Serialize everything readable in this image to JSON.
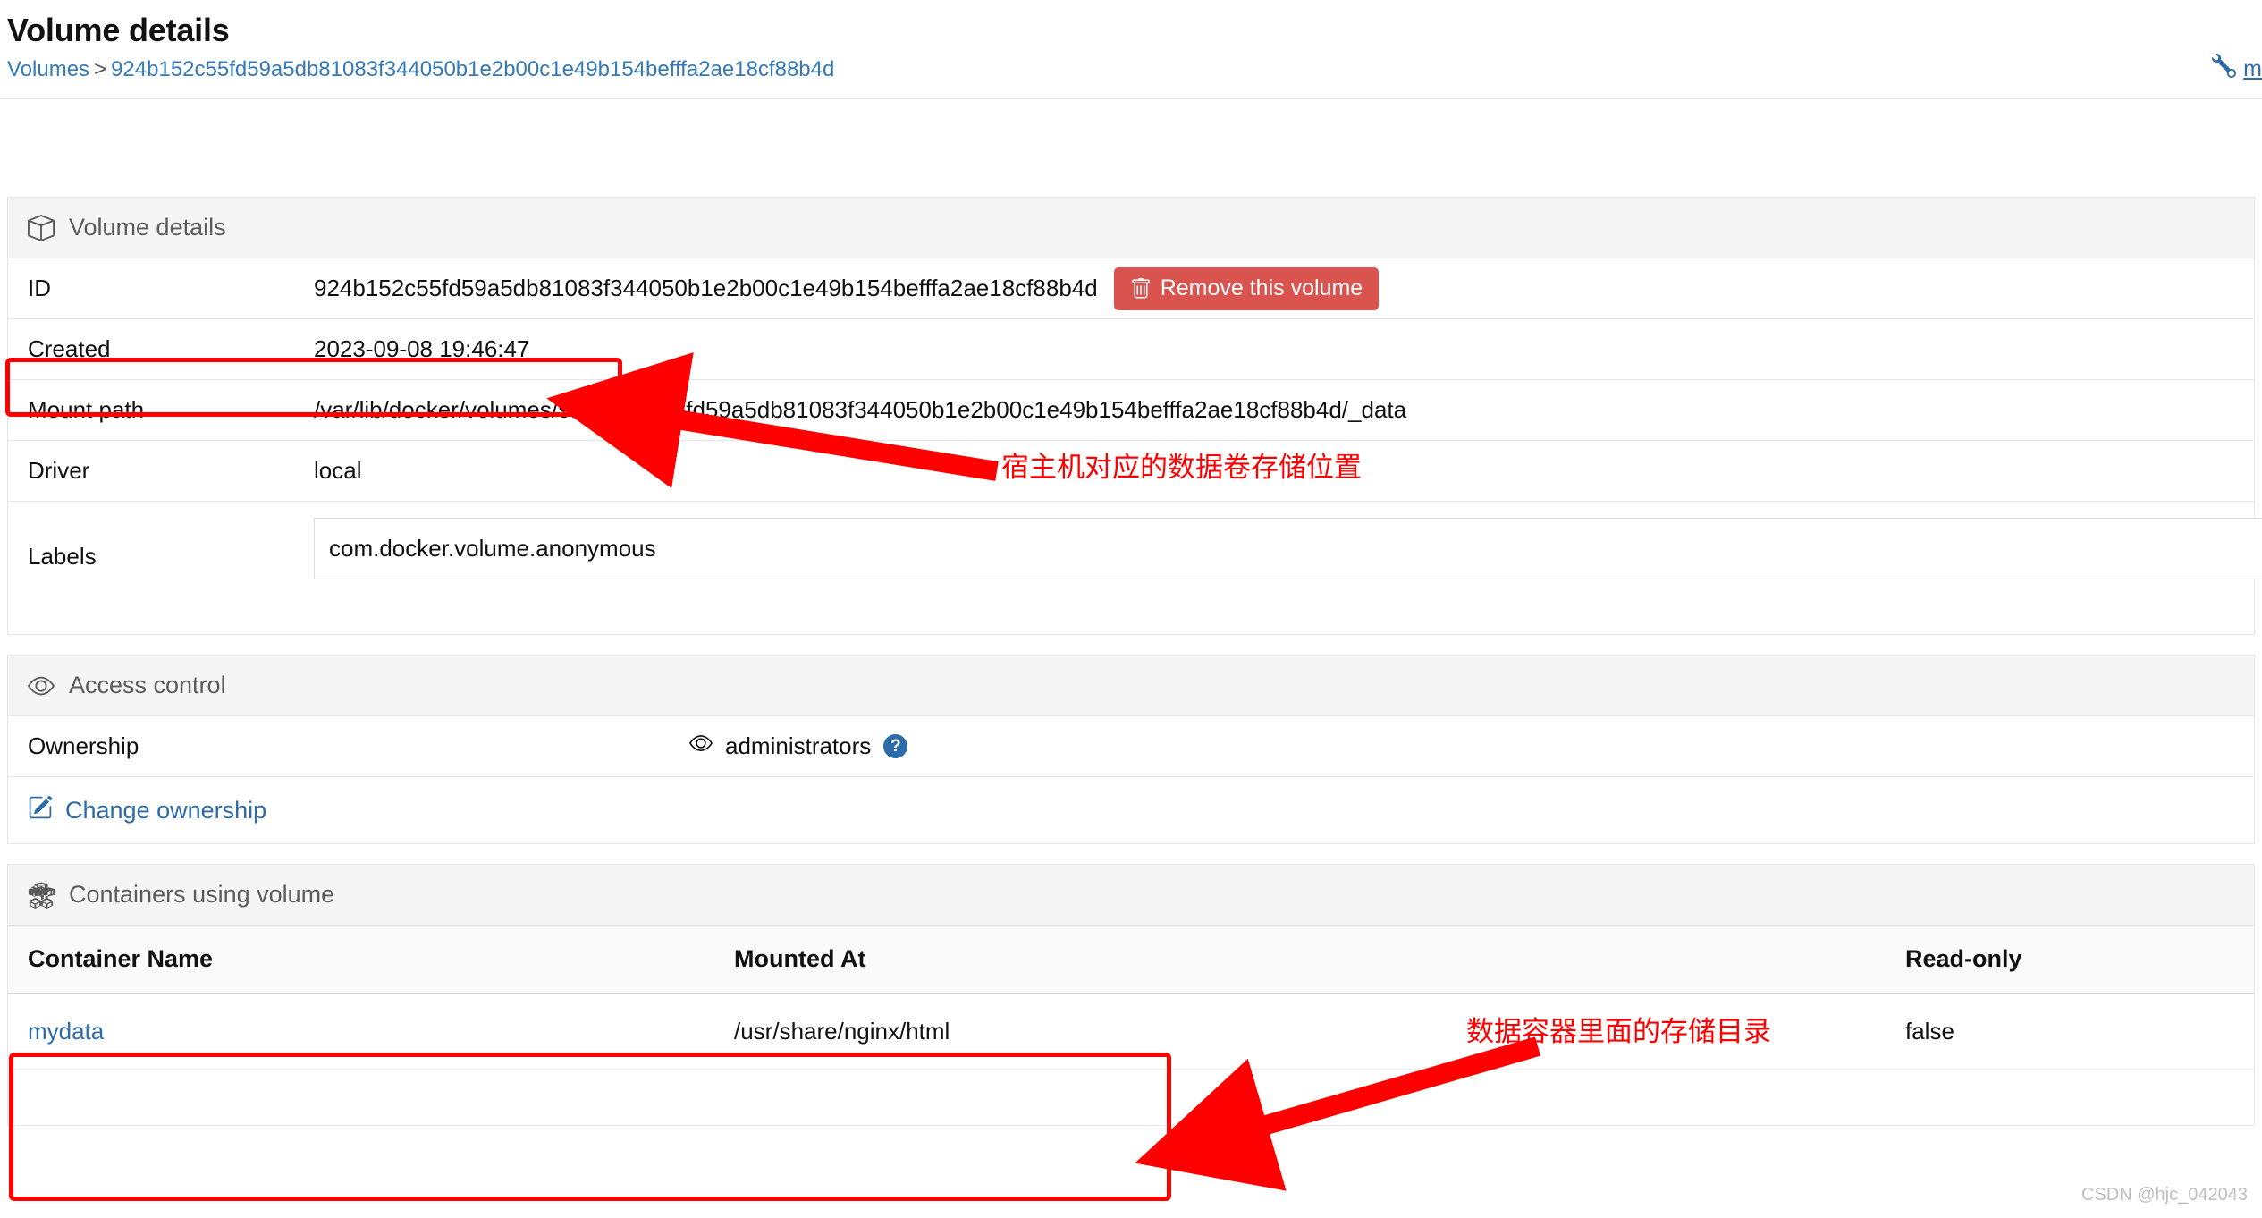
{
  "header": {
    "title": "Volume details",
    "breadcrumb": {
      "root": "Volumes",
      "separator": ">",
      "current": "924b152c55fd59a5db81083f344050b1e2b00c1e49b154befffa2ae18cf88b4d"
    },
    "right_link": {
      "icon": "wrench-icon",
      "label": "m"
    }
  },
  "volume_details": {
    "section_title": "Volume details",
    "section_icon": "cube-icon",
    "rows": [
      {
        "label": "ID",
        "value": "924b152c55fd59a5db81083f344050b1e2b00c1e49b154befffa2ae18cf88b4d"
      },
      {
        "label": "Created",
        "value": "2023-09-08 19:46:47"
      },
      {
        "label": "Mount path",
        "value": "/var/lib/docker/volumes/924b152c55fd59a5db81083f344050b1e2b00c1e49b154befffa2ae18cf88b4d/_data"
      },
      {
        "label": "Driver",
        "value": "local"
      },
      {
        "label": "Labels",
        "value": "com.docker.volume.anonymous"
      }
    ],
    "remove_button": {
      "label": "Remove this volume",
      "icon": "trash-icon",
      "color": "#d9534f"
    }
  },
  "access_control": {
    "section_title": "Access control",
    "section_icon": "eye-icon",
    "ownership_label": "Ownership",
    "ownership_value": "administrators",
    "ownership_icon": "eye-icon",
    "help_icon": "question-circle-icon",
    "change_ownership_label": "Change ownership",
    "change_ownership_icon": "edit-square-icon"
  },
  "containers": {
    "section_title": "Containers using volume",
    "section_icon": "boxes-icon",
    "columns": [
      "Container Name",
      "Mounted At",
      "Read-only"
    ],
    "rows": [
      {
        "name": "mydata",
        "mounted_at": "/usr/share/nginx/html",
        "read_only": "false"
      }
    ]
  },
  "annotations": {
    "mount_path_note": "宿主机对应的数据卷存储位置",
    "containers_note": "数据容器里面的存储目录",
    "highlight_color": "#ff0000"
  },
  "watermark": "CSDN @hjc_042043"
}
